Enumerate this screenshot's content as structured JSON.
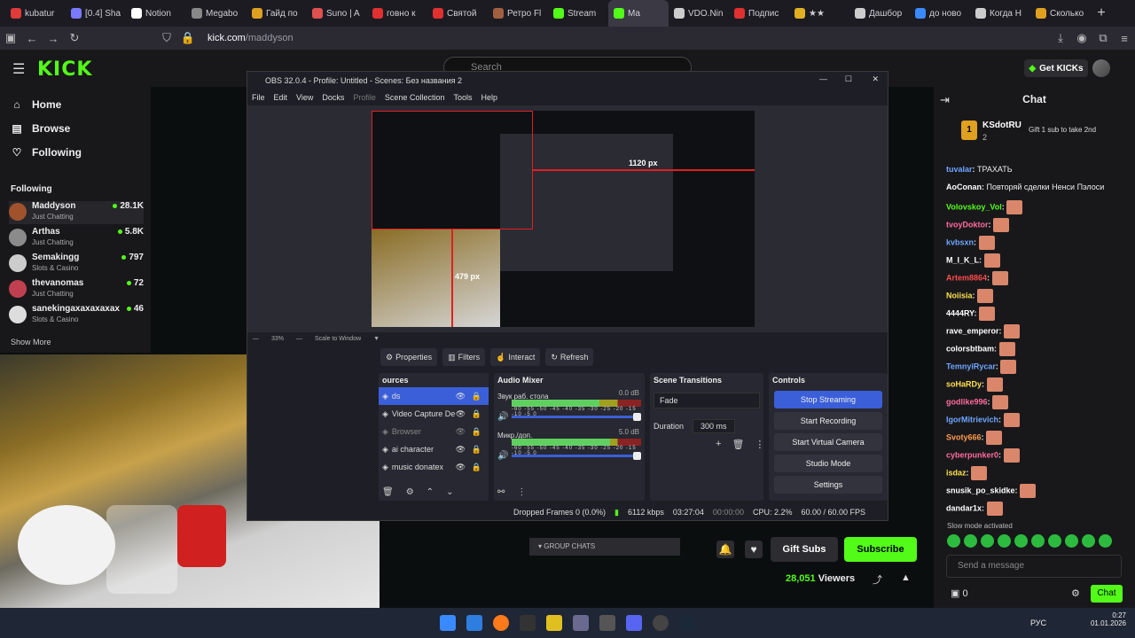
{
  "browser": {
    "tabs": [
      {
        "label": "kubatur",
        "color": "#e03a3a"
      },
      {
        "label": "[0.4] Sha",
        "color": "#7a7aff"
      },
      {
        "label": "Notion",
        "color": "#ffffff"
      },
      {
        "label": "Megabo",
        "color": "#888888"
      },
      {
        "label": "Гайд по",
        "color": "#e0a020"
      },
      {
        "label": "Suno | A",
        "color": "#e05050"
      },
      {
        "label": "говно к",
        "color": "#e03030"
      },
      {
        "label": "Святой",
        "color": "#e03030"
      },
      {
        "label": "Ретро Fl",
        "color": "#a06040"
      },
      {
        "label": "Stream",
        "color": "#53fc18"
      },
      {
        "label": "Ma",
        "color": "#53fc18"
      },
      {
        "label": "VDO.Nin",
        "color": "#cccccc"
      },
      {
        "label": "Подпис",
        "color": "#e03030"
      },
      {
        "label": "★★",
        "color": "#e0b020"
      },
      {
        "label": "Дашбор",
        "color": "#cccccc"
      },
      {
        "label": "до ново",
        "color": "#3a8aff"
      },
      {
        "label": "Когда Н",
        "color": "#cccccc"
      },
      {
        "label": "Сколько",
        "color": "#e0a020"
      }
    ],
    "url_host": "kick.com",
    "url_path": "/maddyson"
  },
  "kick": {
    "logo": "KICK",
    "search_placeholder": "Search",
    "get_kicks": "Get KICKs",
    "nav": {
      "home": "Home",
      "browse": "Browse",
      "following": "Following"
    },
    "following_title": "Following",
    "channels": [
      {
        "name": "Maddyson",
        "sub": "Just Chatting",
        "viewers": "28.1K",
        "color": "#a0522d"
      },
      {
        "name": "Arthas",
        "sub": "Just Chatting",
        "viewers": "5.8K",
        "color": "#8b8b8b"
      },
      {
        "name": "Semakingg",
        "sub": "Slots & Casino",
        "viewers": "797",
        "color": "#cccccc"
      },
      {
        "name": "thevanomas",
        "sub": "Just Chatting",
        "viewers": "72",
        "color": "#c04050"
      },
      {
        "name": "sanekingaxaxaxaxax",
        "sub": "Slots & Casino",
        "viewers": "46",
        "color": "#dddddd"
      }
    ],
    "show_more": "Show More",
    "group_chats": "GROUP CHATS",
    "gift_subs": "Gift Subs",
    "subscribe": "Subscribe",
    "viewers": "28,051",
    "viewers_label": "Viewers"
  },
  "obs": {
    "title": "OBS 32.0.4 - Profile: Untitled - Scenes: Без названия 2",
    "menu": [
      "File",
      "Edit",
      "View",
      "Docks",
      "Profile",
      "Scene Collection",
      "Tools",
      "Help"
    ],
    "px_width_label": "1120 px",
    "px_height_label": "479 px",
    "zoom": "33%",
    "scale_mode": "Scale to Window",
    "toolbar": {
      "properties": "Properties",
      "filters": "Filters",
      "interact": "Interact",
      "refresh": "Refresh"
    },
    "sources_title": "ources",
    "sources": [
      {
        "name": "ds",
        "selected": true,
        "dim": false
      },
      {
        "name": "Video Capture De",
        "selected": false,
        "dim": false
      },
      {
        "name": "Browser",
        "selected": false,
        "dim": true
      },
      {
        "name": "ai character",
        "selected": false,
        "dim": false
      },
      {
        "name": "music donatex",
        "selected": false,
        "dim": false
      }
    ],
    "mixer_title": "Audio Mixer",
    "mixer": [
      {
        "name": "Звук раб. стола",
        "db": "0.0 dB",
        "level": 0.68
      },
      {
        "name": "Микр./доп.",
        "db": "5.0 dB",
        "level": 0.76
      }
    ],
    "mixer_scale": "-60 -55 -50 -45 -40 -35 -30 -25 -20 -15 -10 -5 0",
    "transitions_title": "Scene Transitions",
    "transition": "Fade",
    "duration_label": "Duration",
    "duration": "300 ms",
    "controls_title": "Controls",
    "controls": [
      "Stop Streaming",
      "Start Recording",
      "Start Virtual Camera",
      "Studio Mode",
      "Settings"
    ],
    "status": {
      "dropped": "Dropped Frames 0 (0.0%)",
      "bitrate": "6112 kbps",
      "stream_time": "03:27:04",
      "rec_time": "00:00:00",
      "cpu": "CPU: 2.2%",
      "fps": "60.00 / 60.00 FPS"
    }
  },
  "chat": {
    "title": "Chat",
    "pinned_user": "KSdotRU",
    "pinned_rank": "1",
    "pinned_count": "2",
    "gift_hint": "Gift 1 sub to take 2nd",
    "messages": [
      {
        "user": "tuvalar",
        "color": "#6ea6ff",
        "text": "ТРАХАТЬ",
        "emote": false
      },
      {
        "user": "AoConan",
        "color": "#ffffff",
        "text": "Повторяй сделки Ненси Пэлоси",
        "emote": false
      },
      {
        "user": "Volovskoy_Vol",
        "color": "#53fc18",
        "text": "",
        "emote": true
      },
      {
        "user": "tvoyDoktor",
        "color": "#ff6b9a",
        "text": "",
        "emote": true
      },
      {
        "user": "kvbsxn",
        "color": "#6ea6ff",
        "text": "",
        "emote": true
      },
      {
        "user": "M_I_K_L",
        "color": "#ffffff",
        "text": "",
        "emote": true
      },
      {
        "user": "Artem8864",
        "color": "#ff4b4b",
        "text": "",
        "emote": true
      },
      {
        "user": "Noiisia",
        "color": "#ffe14b",
        "text": "",
        "emote": true
      },
      {
        "user": "4444RY",
        "color": "#ffffff",
        "text": "",
        "emote": true
      },
      {
        "user": "rave_emperor",
        "color": "#ffffff",
        "text": "",
        "emote": true
      },
      {
        "user": "colorsbtbam",
        "color": "#ffffff",
        "text": "",
        "emote": true
      },
      {
        "user": "TemnyiRycar",
        "color": "#6ea6ff",
        "text": "",
        "emote": true
      },
      {
        "user": "soHaRDy",
        "color": "#ffe14b",
        "text": "",
        "emote": true
      },
      {
        "user": "godlike996",
        "color": "#ff6b9a",
        "text": "",
        "emote": true
      },
      {
        "user": "IgorMitrievich",
        "color": "#6ea6ff",
        "text": "",
        "emote": true
      },
      {
        "user": "Svoty666",
        "color": "#ff9b4b",
        "text": "",
        "emote": true
      },
      {
        "user": "cyberpunker0",
        "color": "#ff6b9a",
        "text": "",
        "emote": true
      },
      {
        "user": "isdaz",
        "color": "#ffe14b",
        "text": "",
        "emote": true
      },
      {
        "user": "snusik_po_skidke",
        "color": "#ffffff",
        "text": "",
        "emote": true
      },
      {
        "user": "dandar1x",
        "color": "#ffffff",
        "text": "",
        "emote": true
      }
    ],
    "slow_mode": "Slow mode activated",
    "send_placeholder": "Send a message",
    "points": "0",
    "chat_button": "Chat"
  },
  "taskbar": {
    "lang": "РУС",
    "time": "0:27",
    "date": "01.01.2026"
  }
}
